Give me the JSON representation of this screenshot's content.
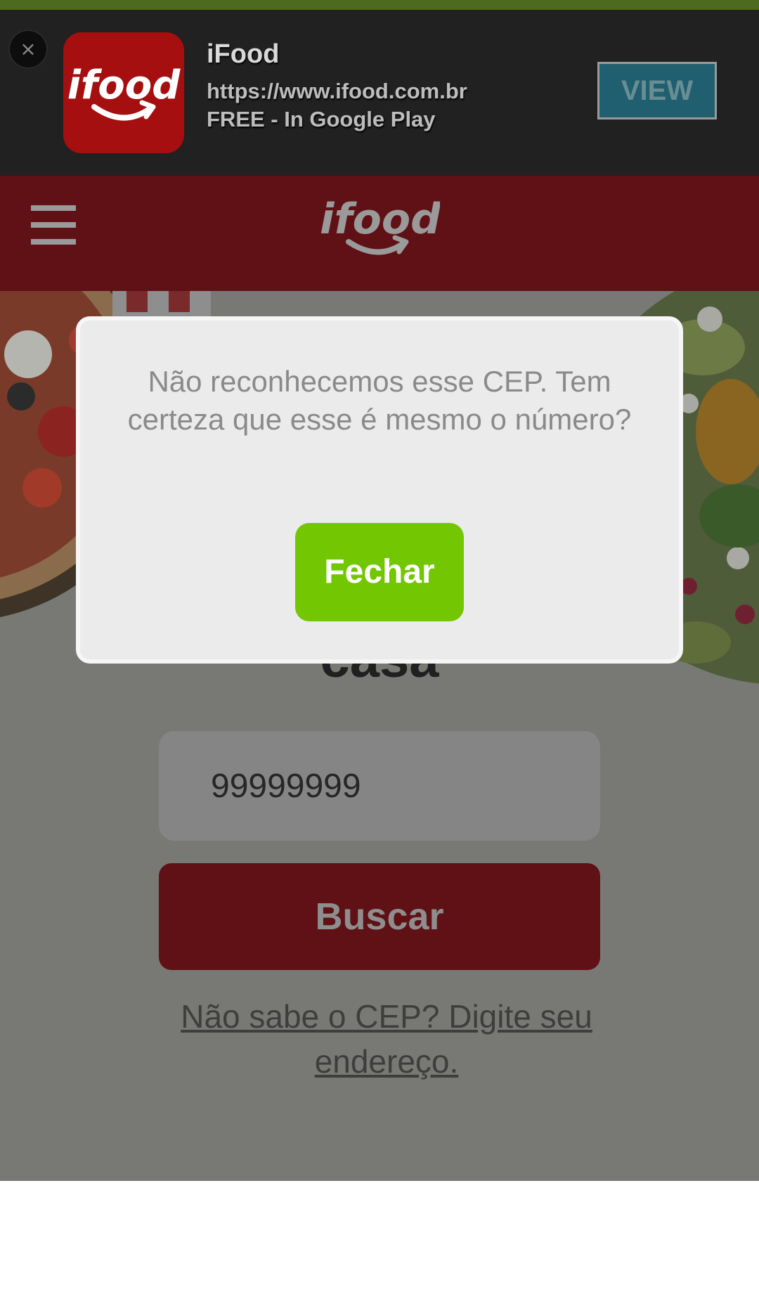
{
  "app_banner": {
    "close_glyph": "×",
    "app_icon": "ifood-app-icon",
    "app_icon_text": "ifood",
    "title": "iFood",
    "url": "https://www.ifood.com.br",
    "store_text": "FREE - In Google Play",
    "view_label": "VIEW"
  },
  "header": {
    "menu_icon": "hamburger-menu-icon",
    "logo": "ifood-logo",
    "logo_text": "ifood",
    "background_color": "#5f1115"
  },
  "hero": {
    "heading_visible_fragment": "casa",
    "cep_input_value": "99999999",
    "search_button_label": "Buscar",
    "address_link_text": "Não sabe o CEP? Digite seu endereço."
  },
  "modal": {
    "message": "Não reconhecemos esse CEP. Tem certeza que esse é mesmo o número?",
    "close_button_label": "Fechar",
    "close_button_color": "#73c702"
  }
}
